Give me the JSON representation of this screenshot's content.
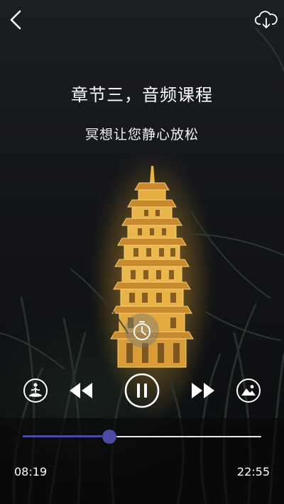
{
  "header": {
    "back_icon": "chevron-left-icon",
    "download_icon": "cloud-download-icon"
  },
  "lesson": {
    "title": "章节三，音频课程",
    "subtitle": "冥想让您静心放松"
  },
  "timer": {
    "icon": "timer-icon"
  },
  "controls": {
    "meditation_icon": "meditation-figure-icon",
    "rewind_icon": "rewind-icon",
    "pause_icon": "pause-icon",
    "forward_icon": "fast-forward-icon",
    "background_icon": "image-icon"
  },
  "playback": {
    "elapsed": "08:19",
    "total": "22:55",
    "progress_fraction": 0.363
  },
  "colors": {
    "accent": "#4b4ba6",
    "pagoda_light": "#e8b445",
    "text": "#ffffff"
  }
}
